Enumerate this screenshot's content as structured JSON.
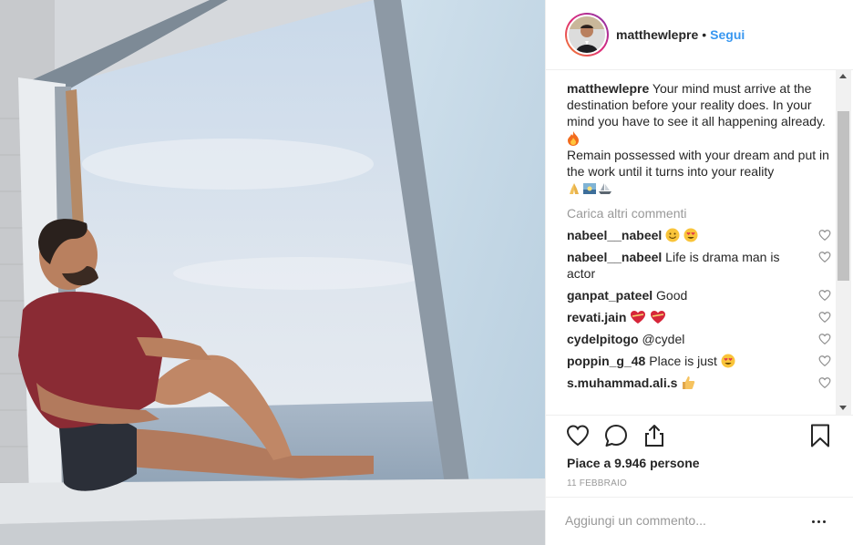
{
  "post": {
    "photo_alt": "",
    "header": {
      "username": "matthewlepre",
      "separator": "•",
      "follow_label": "Segui"
    },
    "caption": {
      "username": "matthewlepre",
      "line1": "Your mind must arrive at the destination before your reality does. In your mind you have to see it all happening already.",
      "line2": "Remain possessed with your dream and put in the work until it turns into your reality"
    },
    "load_more_label": "Carica altri commenti",
    "comments": [
      {
        "username": "nabeel__nabeel",
        "text": ""
      },
      {
        "username": "nabeel__nabeel",
        "text": "Life is drama man is actor"
      },
      {
        "username": "ganpat_pateel",
        "text": "Good"
      },
      {
        "username": "revati.jain",
        "text": ""
      },
      {
        "username": "cydelpitogo",
        "text": "@cydel"
      },
      {
        "username": "poppin_g_48",
        "text": "Place is just"
      },
      {
        "username": "s.muhammad.ali.s",
        "text": ""
      }
    ],
    "likes_label": "Piace a 9.946 persone",
    "date_label": "11 FEBBRAIO",
    "comment_placeholder": "Aggiungi un commento..."
  },
  "colors": {
    "link": "#3897f0",
    "text": "#262626",
    "muted": "#999999",
    "border": "#efefef"
  }
}
